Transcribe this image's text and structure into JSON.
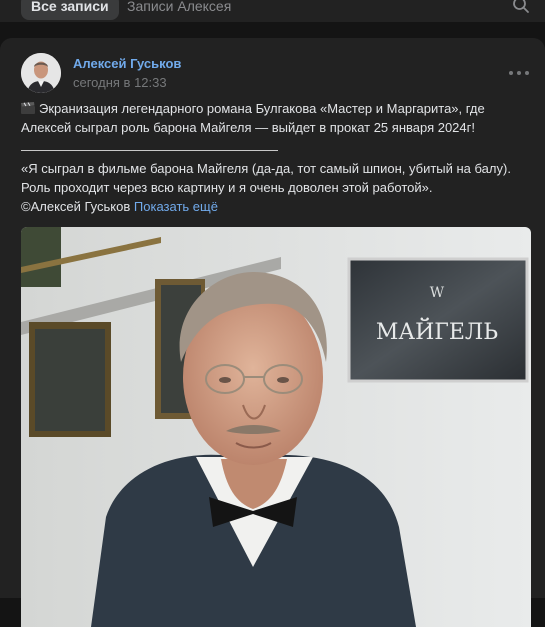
{
  "tabs": {
    "active": "Все записи",
    "inactive": "Записи Алексея"
  },
  "post": {
    "author": "Алексей Гуськов",
    "time": "сегодня в 12:33",
    "text_line1": "Экранизация легендарного романа Булгакова «Мастер и Маргарита», где Алексей сыграл роль барона Майгеля — выйдет в прокат 25 января 2024г!",
    "quote_line1": "«Я сыграл в фильме барона Майгеля (да-да, тот самый шпион, убитый на балу).",
    "quote_line2": "Роль проходит через всю картину и я очень доволен этой работой».",
    "copyright": "©Алексей Гуськов",
    "show_more": "Показать ещё",
    "sign_letter": "W",
    "sign_name": "МАЙГЕЛЬ"
  },
  "icons": {
    "search": "search-icon",
    "more": "more-dots-icon",
    "clapper": "clapperboard-icon"
  },
  "colors": {
    "background": "#141414",
    "card": "#222222",
    "link": "#71aaeb",
    "muted": "#76787a"
  }
}
